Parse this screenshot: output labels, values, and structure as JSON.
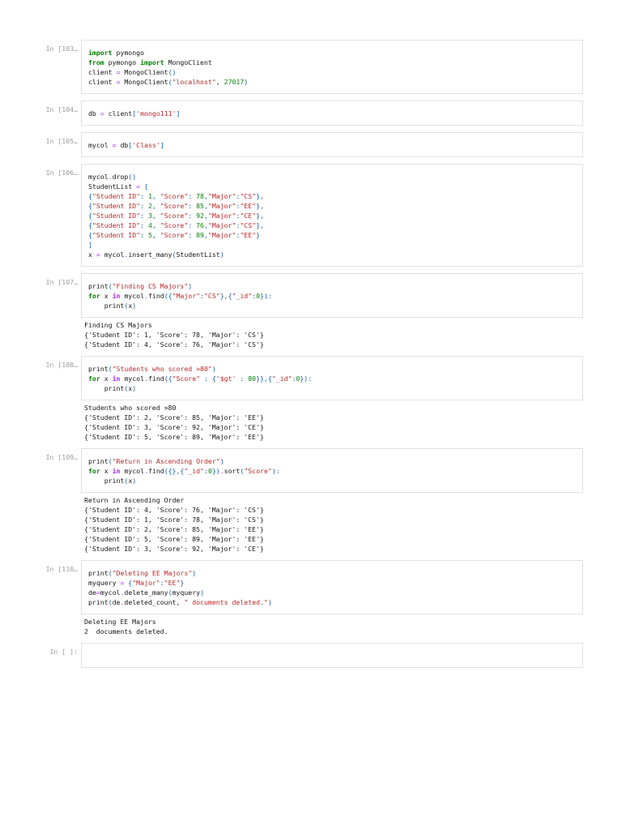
{
  "cells": [
    {
      "prompt": "In [103…",
      "code": [
        [
          [
            "import",
            "kw"
          ],
          [
            " pymongo",
            ""
          ]
        ],
        [
          [
            "from",
            "kw"
          ],
          [
            " pymongo ",
            ""
          ],
          [
            "import",
            "kw"
          ],
          [
            " MongoClient",
            ""
          ]
        ],
        [
          [
            "client ",
            ""
          ],
          [
            "=",
            "o"
          ],
          [
            " MongoClient",
            ""
          ],
          [
            "()",
            "p"
          ]
        ],
        [
          [
            "client ",
            ""
          ],
          [
            "=",
            "o"
          ],
          [
            " MongoClient",
            ""
          ],
          [
            "(",
            "p"
          ],
          [
            "\"localhost\"",
            "s"
          ],
          [
            ", ",
            ""
          ],
          [
            "27017",
            "n"
          ],
          [
            ")",
            "p"
          ]
        ]
      ],
      "output": []
    },
    {
      "prompt": "In [104…",
      "code": [
        [
          [
            "db ",
            ""
          ],
          [
            "=",
            "o"
          ],
          [
            " client",
            ""
          ],
          [
            "[",
            "p"
          ],
          [
            "'mongo111'",
            "s"
          ],
          [
            "]",
            "p"
          ]
        ]
      ],
      "output": []
    },
    {
      "prompt": "In [105…",
      "code": [
        [
          [
            "mycol ",
            ""
          ],
          [
            "=",
            "o"
          ],
          [
            " db",
            ""
          ],
          [
            "[",
            "p"
          ],
          [
            "'Class'",
            "s"
          ],
          [
            "]",
            "p"
          ]
        ]
      ],
      "output": []
    },
    {
      "prompt": "In [106…",
      "code": [
        [
          [
            "mycol",
            ""
          ],
          [
            ".",
            "o"
          ],
          [
            "drop",
            ""
          ],
          [
            "()",
            "p"
          ]
        ],
        [
          [
            "StudentList ",
            ""
          ],
          [
            "=",
            "o"
          ],
          [
            " ",
            ""
          ],
          [
            "[",
            "p"
          ]
        ],
        [
          [
            "{",
            "p"
          ],
          [
            "\"Student ID\"",
            "s"
          ],
          [
            ": ",
            "p"
          ],
          [
            "1",
            "n"
          ],
          [
            ", ",
            "p"
          ],
          [
            "\"Score\"",
            "s"
          ],
          [
            ": ",
            "p"
          ],
          [
            "78",
            "n"
          ],
          [
            ",",
            "p"
          ],
          [
            "\"Major\"",
            "s"
          ],
          [
            ":",
            "p"
          ],
          [
            "\"CS\"",
            "s"
          ],
          [
            "},",
            "p"
          ]
        ],
        [
          [
            "{",
            "p"
          ],
          [
            "\"Student ID\"",
            "s"
          ],
          [
            ": ",
            "p"
          ],
          [
            "2",
            "n"
          ],
          [
            ", ",
            "p"
          ],
          [
            "\"Score\"",
            "s"
          ],
          [
            ": ",
            "p"
          ],
          [
            "85",
            "n"
          ],
          [
            ",",
            "p"
          ],
          [
            "\"Major\"",
            "s"
          ],
          [
            ":",
            "p"
          ],
          [
            "\"EE\"",
            "s"
          ],
          [
            "},",
            "p"
          ]
        ],
        [
          [
            "{",
            "p"
          ],
          [
            "\"Student ID\"",
            "s"
          ],
          [
            ": ",
            "p"
          ],
          [
            "3",
            "n"
          ],
          [
            ", ",
            "p"
          ],
          [
            "\"Score\"",
            "s"
          ],
          [
            ": ",
            "p"
          ],
          [
            "92",
            "n"
          ],
          [
            ",",
            "p"
          ],
          [
            "\"Major\"",
            "s"
          ],
          [
            ":",
            "p"
          ],
          [
            "\"CE\"",
            "s"
          ],
          [
            "},",
            "p"
          ]
        ],
        [
          [
            "{",
            "p"
          ],
          [
            "\"Student ID\"",
            "s"
          ],
          [
            ": ",
            "p"
          ],
          [
            "4",
            "n"
          ],
          [
            ", ",
            "p"
          ],
          [
            "\"Score\"",
            "s"
          ],
          [
            ": ",
            "p"
          ],
          [
            "76",
            "n"
          ],
          [
            ",",
            "p"
          ],
          [
            "\"Major\"",
            "s"
          ],
          [
            ":",
            "p"
          ],
          [
            "\"CS\"",
            "s"
          ],
          [
            "},",
            "p"
          ]
        ],
        [
          [
            "{",
            "p"
          ],
          [
            "\"Student ID\"",
            "s"
          ],
          [
            ": ",
            "p"
          ],
          [
            "5",
            "n"
          ],
          [
            ", ",
            "p"
          ],
          [
            "\"Score\"",
            "s"
          ],
          [
            ": ",
            "p"
          ],
          [
            "89",
            "n"
          ],
          [
            ",",
            "p"
          ],
          [
            "\"Major\"",
            "s"
          ],
          [
            ":",
            "p"
          ],
          [
            "\"EE\"",
            "s"
          ],
          [
            "}",
            "p"
          ]
        ],
        [
          [
            "]",
            "p"
          ]
        ],
        [
          [
            "x ",
            ""
          ],
          [
            "=",
            "o"
          ],
          [
            " mycol",
            ""
          ],
          [
            ".",
            "o"
          ],
          [
            "insert_many",
            ""
          ],
          [
            "(",
            "p"
          ],
          [
            "StudentList",
            ""
          ],
          [
            ")",
            "p"
          ]
        ]
      ],
      "output": []
    },
    {
      "prompt": "In [107…",
      "code": [
        [
          [
            "print",
            ""
          ],
          [
            "(",
            "p"
          ],
          [
            "\"Finding CS Majors\"",
            "s"
          ],
          [
            ")",
            "p"
          ]
        ],
        [
          [
            "for",
            "kw"
          ],
          [
            " x ",
            ""
          ],
          [
            "in",
            "in"
          ],
          [
            " mycol",
            ""
          ],
          [
            ".",
            "o"
          ],
          [
            "find",
            ""
          ],
          [
            "({",
            "p"
          ],
          [
            "\"Major\"",
            "s"
          ],
          [
            ":",
            "p"
          ],
          [
            "\"CS\"",
            "s"
          ],
          [
            "},{",
            "p"
          ],
          [
            "\"_id\"",
            "s"
          ],
          [
            ":",
            "p"
          ],
          [
            "0",
            "n"
          ],
          [
            "}):",
            "p"
          ]
        ],
        [
          [
            "    print",
            ""
          ],
          [
            "(",
            "p"
          ],
          [
            "x",
            ""
          ],
          [
            ")",
            "p"
          ]
        ]
      ],
      "output": [
        "Finding CS Majors",
        "{'Student ID': 1, 'Score': 78, 'Major': 'CS'}",
        "{'Student ID': 4, 'Score': 76, 'Major': 'CS'}"
      ]
    },
    {
      "prompt": "In [108…",
      "code": [
        [
          [
            "print",
            ""
          ],
          [
            "(",
            "p"
          ],
          [
            "\"Students who scored >80\"",
            "s"
          ],
          [
            ")",
            "p"
          ]
        ],
        [
          [
            "for",
            "kw"
          ],
          [
            " x ",
            ""
          ],
          [
            "in",
            "in"
          ],
          [
            " mycol",
            ""
          ],
          [
            ".",
            "o"
          ],
          [
            "find",
            ""
          ],
          [
            "({",
            "p"
          ],
          [
            "\"Score\"",
            "s"
          ],
          [
            " : {",
            "p"
          ],
          [
            "'$gt'",
            "s"
          ],
          [
            " : ",
            "p"
          ],
          [
            "80",
            "n"
          ],
          [
            "}},{",
            "p"
          ],
          [
            "\"_id\"",
            "s"
          ],
          [
            ":",
            "p"
          ],
          [
            "0",
            "n"
          ],
          [
            "}):",
            "p"
          ]
        ],
        [
          [
            "    print",
            ""
          ],
          [
            "(",
            "p"
          ],
          [
            "x",
            ""
          ],
          [
            ")",
            "p"
          ]
        ]
      ],
      "output": [
        "Students who scored >80",
        "{'Student ID': 2, 'Score': 85, 'Major': 'EE'}",
        "{'Student ID': 3, 'Score': 92, 'Major': 'CE'}",
        "{'Student ID': 5, 'Score': 89, 'Major': 'EE'}"
      ]
    },
    {
      "prompt": "In [109…",
      "code": [
        [
          [
            "print",
            ""
          ],
          [
            "(",
            "p"
          ],
          [
            "\"Return in Ascending Order\"",
            "s"
          ],
          [
            ")",
            "p"
          ]
        ],
        [
          [
            "for",
            "kw"
          ],
          [
            " x ",
            ""
          ],
          [
            "in",
            "in"
          ],
          [
            " mycol",
            ""
          ],
          [
            ".",
            "o"
          ],
          [
            "find",
            ""
          ],
          [
            "({},{",
            "p"
          ],
          [
            "\"_id\"",
            "s"
          ],
          [
            ":",
            "p"
          ],
          [
            "0",
            "n"
          ],
          [
            "})",
            "p"
          ],
          [
            ".",
            "o"
          ],
          [
            "sort",
            ""
          ],
          [
            "(",
            "p"
          ],
          [
            "\"Score\"",
            "s"
          ],
          [
            "):",
            "p"
          ]
        ],
        [
          [
            "    print",
            ""
          ],
          [
            "(",
            "p"
          ],
          [
            "x",
            ""
          ],
          [
            ")",
            "p"
          ]
        ]
      ],
      "output": [
        "Return in Ascending Order",
        "{'Student ID': 4, 'Score': 76, 'Major': 'CS'}",
        "{'Student ID': 1, 'Score': 78, 'Major': 'CS'}",
        "{'Student ID': 2, 'Score': 85, 'Major': 'EE'}",
        "{'Student ID': 5, 'Score': 89, 'Major': 'EE'}",
        "{'Student ID': 3, 'Score': 92, 'Major': 'CE'}"
      ]
    },
    {
      "prompt": "In [110…",
      "code": [
        [
          [
            "print",
            ""
          ],
          [
            "(",
            "p"
          ],
          [
            "\"Deleting EE Majors\"",
            "s"
          ],
          [
            ")",
            "p"
          ]
        ],
        [
          [
            "myquery ",
            ""
          ],
          [
            "=",
            "o"
          ],
          [
            " {",
            "p"
          ],
          [
            "\"Major\"",
            "s"
          ],
          [
            ":",
            "p"
          ],
          [
            "\"EE\"",
            "s"
          ],
          [
            "}",
            "p"
          ]
        ],
        [
          [
            "de",
            ""
          ],
          [
            "=",
            "o"
          ],
          [
            "mycol",
            ""
          ],
          [
            ".",
            "o"
          ],
          [
            "delete_many",
            ""
          ],
          [
            "(",
            "p"
          ],
          [
            "myquery",
            ""
          ],
          [
            ")",
            "p"
          ]
        ],
        [
          [
            "print",
            ""
          ],
          [
            "(",
            "p"
          ],
          [
            "de",
            ""
          ],
          [
            ".",
            "o"
          ],
          [
            "deleted_count, ",
            ""
          ],
          [
            "\" documents deleted.\"",
            "s"
          ],
          [
            ")",
            "p"
          ]
        ]
      ],
      "output": [
        "Deleting EE Majors",
        "2  documents deleted."
      ]
    },
    {
      "prompt": "In [ ]:",
      "code": [],
      "output": []
    }
  ]
}
